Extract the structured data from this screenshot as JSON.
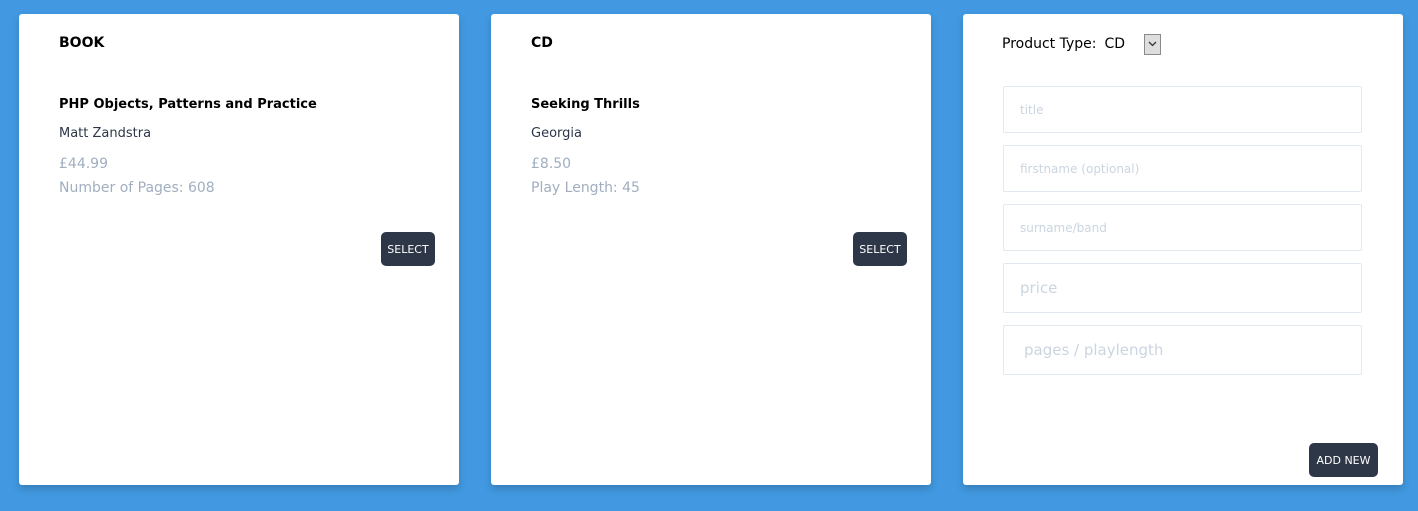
{
  "colors": {
    "background": "#4299e1",
    "card": "#ffffff",
    "button": "#2d3748",
    "muted_text": "#a0aec0"
  },
  "products": [
    {
      "type": "BOOK",
      "title": "PHP Objects, Patterns and Practice",
      "author": "Matt Zandstra",
      "price": "£44.99",
      "attribute": "Number of Pages: 608",
      "select_label": "SELECT"
    },
    {
      "type": "CD",
      "title": "Seeking Thrills",
      "author": "Georgia",
      "price": "£8.50",
      "attribute": "Play Length: 45",
      "select_label": "SELECT"
    }
  ],
  "form": {
    "product_type_label": "Product Type:",
    "product_type_value": "CD",
    "dropdown_icon": "chevron-down-icon",
    "fields": {
      "title_placeholder": "title",
      "firstname_placeholder": "firstname (optional)",
      "surname_placeholder": "surname/band",
      "price_placeholder": "price",
      "pages_placeholder": "pages / playlength"
    },
    "add_label": "ADD NEW"
  }
}
